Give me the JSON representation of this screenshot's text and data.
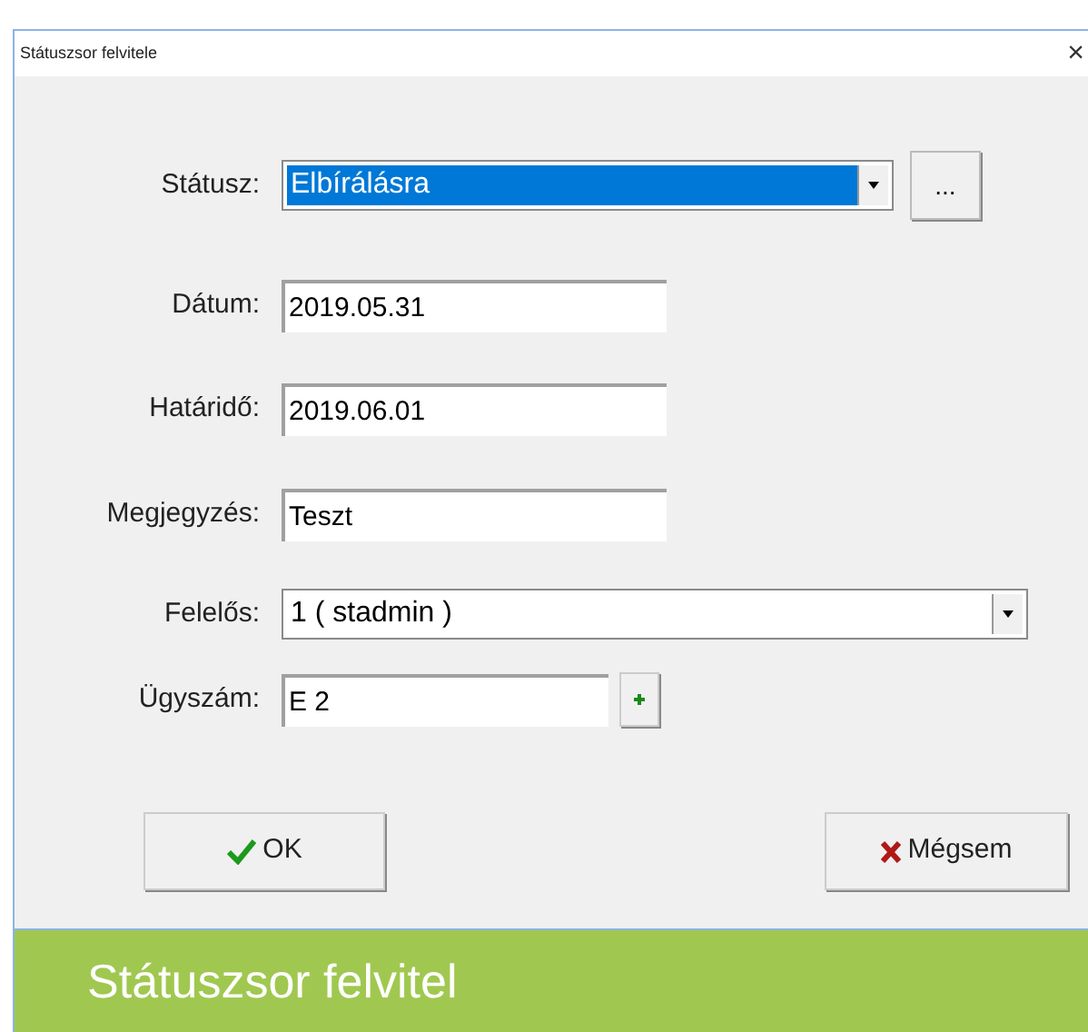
{
  "window": {
    "title": "Státuszsor felvitele",
    "close": "×"
  },
  "fields": [
    {
      "label": "Státusz:",
      "kind": "combo",
      "value": "Elbírálásra",
      "selected": true,
      "extra": "..."
    },
    {
      "label": "Dátum:",
      "kind": "text",
      "value": "2019.05.31"
    },
    {
      "label": "Határidő:",
      "kind": "text",
      "value": "2019.06.01"
    },
    {
      "label": "Megjegyzés:",
      "kind": "text",
      "value": "Teszt"
    },
    {
      "label": "Felelős:",
      "kind": "combo",
      "value": "1 ( stadmin )",
      "selected": false
    },
    {
      "label": "Ügyszám:",
      "kind": "text",
      "value": "E 2",
      "plus": true
    }
  ],
  "buttons": [
    {
      "label": "OK",
      "kind": "ok"
    },
    {
      "label": "Mégsem",
      "kind": "cancel"
    }
  ],
  "caption": "Státuszsor felvitel"
}
